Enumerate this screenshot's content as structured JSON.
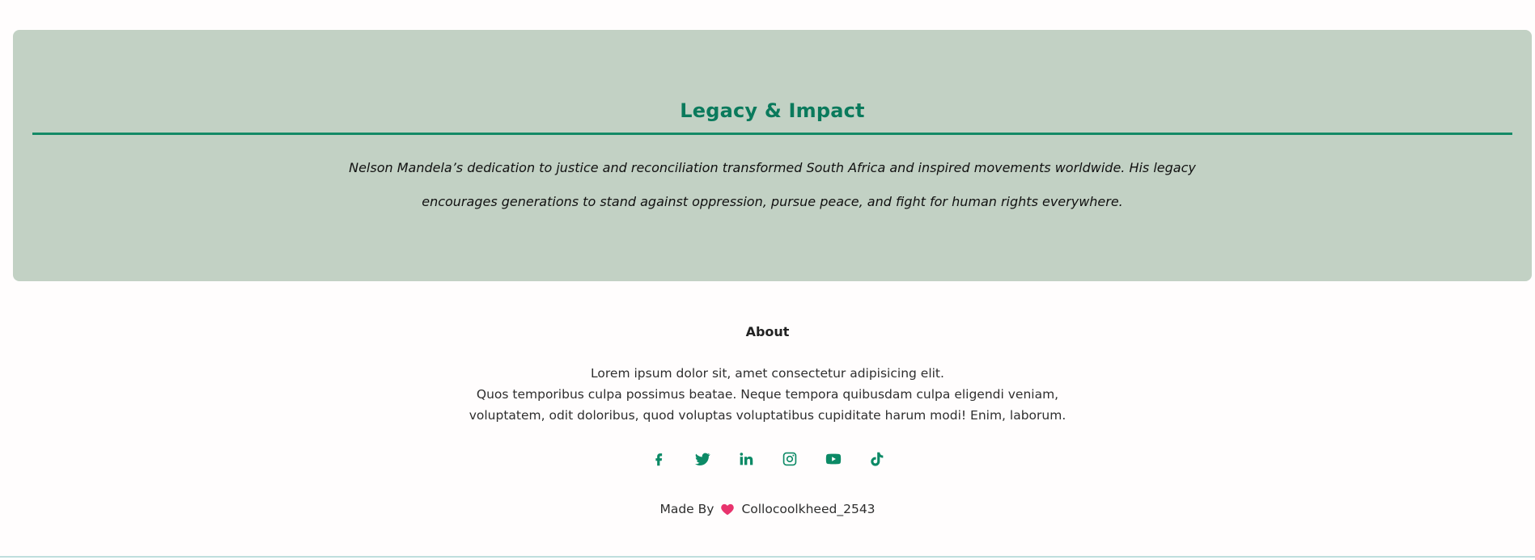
{
  "legacy": {
    "title": "Legacy & Impact",
    "text": "Nelson Mandela’s dedication to justice and reconciliation transformed South Africa and inspired movements worldwide. His legacy encourages generations to stand against oppression, pursue peace, and fight for human rights everywhere."
  },
  "footer": {
    "heading": "About",
    "lines": [
      "Lorem ipsum dolor sit, amet consectetur adipisicing elit.",
      "Quos temporibus culpa possimus beatae. Neque tempora quibusdam culpa eligendi veniam,",
      "voluptatem, odit doloribus, quod voluptas voluptatibus cupiditate harum modi! Enim, laborum."
    ],
    "social_icons": [
      "facebook-icon",
      "twitter-icon",
      "linkedin-icon",
      "instagram-icon",
      "youtube-icon",
      "tiktok-icon"
    ],
    "made_by_prefix": "Made By",
    "made_by_name": "Collocoolkheed_2543"
  },
  "colors": {
    "card_bg": "#c2d1c4",
    "accent_green": "#0a7a5c",
    "heart": "#e8336d"
  }
}
